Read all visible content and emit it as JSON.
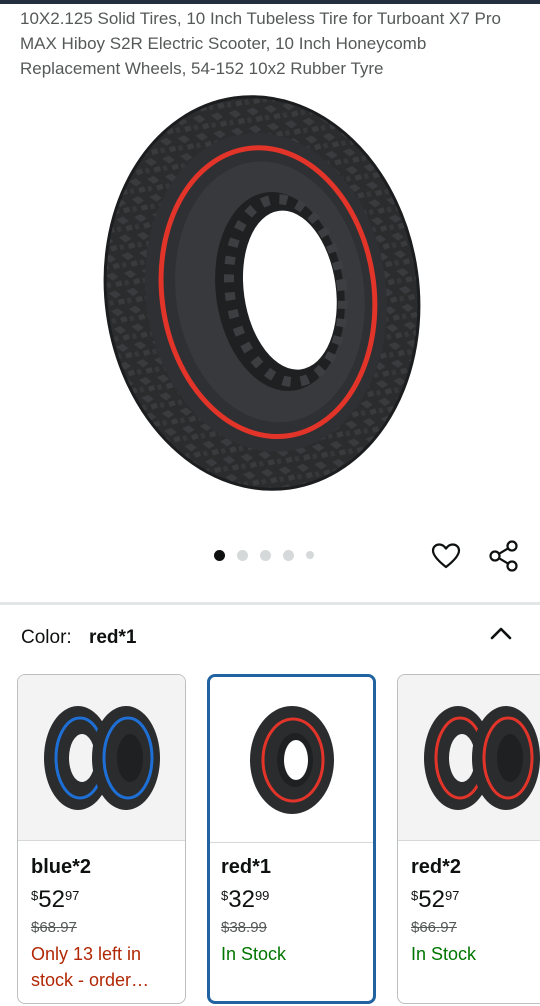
{
  "product": {
    "title": "10X2.125 Solid Tires, 10 Inch Tubeless Tire for Turboant X7 Pro MAX Hiboy S2R Electric Scooter, 10 Inch Honeycomb Replacement Wheels, 54-152 10x2 Rubber Tyre"
  },
  "gallery": {
    "image_count": 5,
    "active_index": 0,
    "tire_colors": {
      "rubber": "#2b2c2e",
      "stripe": "#e3342a",
      "background": "#ffffff"
    }
  },
  "actions": {
    "wishlist_icon": "heart-icon",
    "share_icon": "share-icon"
  },
  "color_selector": {
    "label": "Color:",
    "selected": "red*1",
    "collapse_icon": "chevron-up-icon",
    "options": [
      {
        "name": "blue*2",
        "currency": "$",
        "price_whole": "52",
        "price_cents": "97",
        "list_price": "$68.97",
        "stock": "Only 13 left in stock - order…",
        "stock_status": "low",
        "selected": false,
        "stripe_color": "#1e6fd6",
        "tire_count": 2
      },
      {
        "name": "red*1",
        "currency": "$",
        "price_whole": "32",
        "price_cents": "99",
        "list_price": "$38.99",
        "stock": "In Stock",
        "stock_status": "in",
        "selected": true,
        "stripe_color": "#e3342a",
        "tire_count": 1
      },
      {
        "name": "red*2",
        "currency": "$",
        "price_whole": "52",
        "price_cents": "97",
        "list_price": "$66.97",
        "stock": "In Stock",
        "stock_status": "in",
        "selected": false,
        "stripe_color": "#e3342a",
        "tire_count": 2
      }
    ]
  },
  "colors": {
    "selected_border": "#2162a1",
    "low_stock": "#b12704",
    "in_stock": "#007600",
    "muted_text": "#565959"
  }
}
